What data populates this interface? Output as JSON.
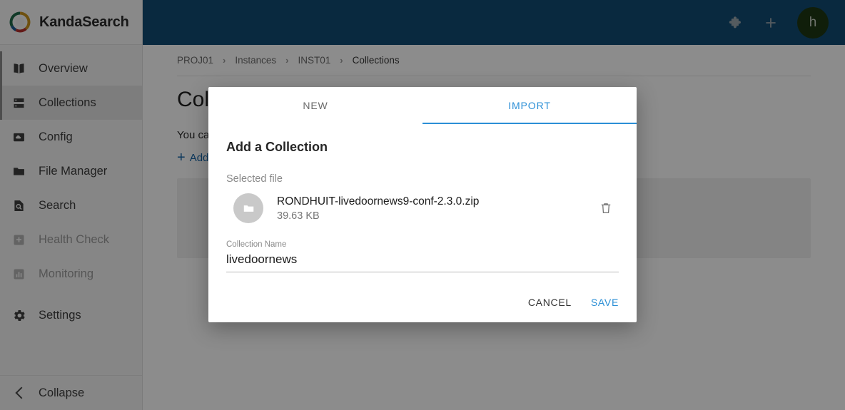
{
  "brand": {
    "name": "KandaSearch",
    "logo_icon": "kandasearch-swirl-logo"
  },
  "sidebar": {
    "items": [
      {
        "label": "Overview",
        "icon": "book-icon",
        "state": "normal"
      },
      {
        "label": "Collections",
        "icon": "server-icon",
        "state": "active"
      },
      {
        "label": "Config",
        "icon": "cloud-box-icon",
        "state": "normal"
      },
      {
        "label": "File Manager",
        "icon": "folder-icon",
        "state": "normal"
      },
      {
        "label": "Search",
        "icon": "doc-search-icon",
        "state": "normal"
      },
      {
        "label": "Health Check",
        "icon": "health-plus-icon",
        "state": "disabled"
      },
      {
        "label": "Monitoring",
        "icon": "bar-chart-icon",
        "state": "disabled"
      },
      {
        "label": "Settings",
        "icon": "gear-icon",
        "state": "normal"
      }
    ],
    "collapse_label": "Collapse",
    "collapse_icon": "chevron-left-icon"
  },
  "topbar": {
    "background": "#114c74",
    "puzzle_icon": "puzzle-piece-icon",
    "add_icon": "plus-icon",
    "avatar_initial": "h",
    "avatar_color": "#1e3813"
  },
  "page": {
    "breadcrumb": [
      {
        "label": "PROJ01",
        "current": false
      },
      {
        "label": "Instances",
        "current": false
      },
      {
        "label": "INST01",
        "current": false
      },
      {
        "label": "Collections",
        "current": true
      }
    ],
    "breadcrumb_separator": "›",
    "title": "Collections",
    "description": "You can add or delete collections here. Please restart the instance to reload the collection.",
    "add_link_label": "Add a Collection",
    "add_link_icon": "plus-icon"
  },
  "modal": {
    "tabs": [
      {
        "label": "NEW",
        "active": false
      },
      {
        "label": "IMPORT",
        "active": true
      }
    ],
    "accent_color": "#2b8fd6",
    "heading": "Add a Collection",
    "selected_file_label": "Selected file",
    "file": {
      "name": "RONDHUIT-livedoornews9-conf-2.3.0.zip",
      "size": "39.63 KB",
      "icon": "folder-icon",
      "delete_icon": "trash-icon"
    },
    "collection_name": {
      "label": "Collection Name",
      "value": "livedoornews",
      "placeholder": "Collection Name"
    },
    "cancel_label": "CANCEL",
    "save_label": "SAVE"
  }
}
